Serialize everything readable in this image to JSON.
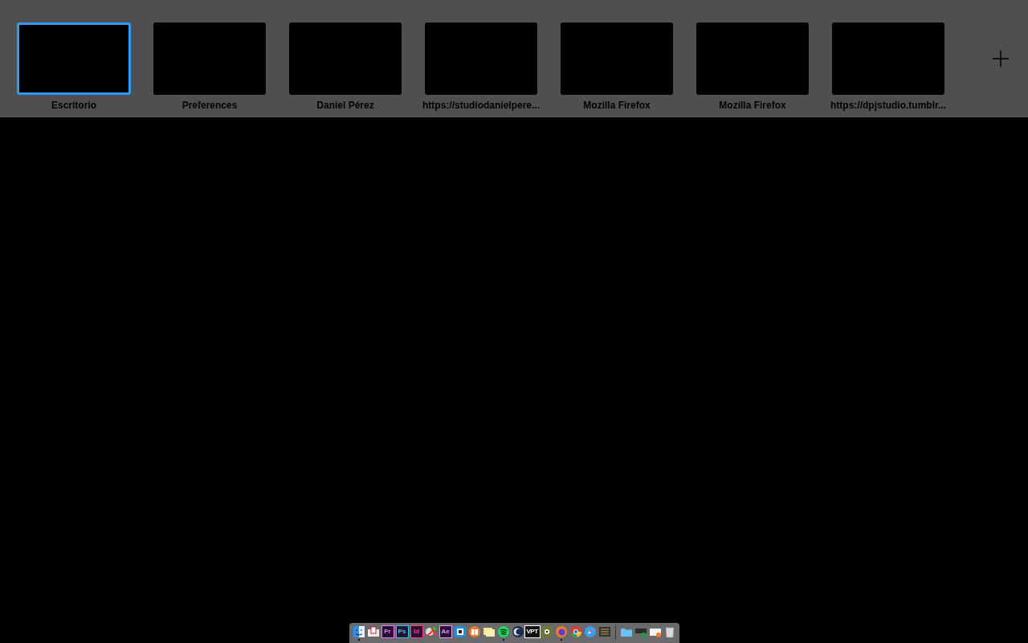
{
  "spaces": [
    {
      "label": "Escritorio",
      "selected": true
    },
    {
      "label": "Preferences",
      "selected": false
    },
    {
      "label": "Daniel Pérez",
      "selected": false
    },
    {
      "label": "https://studiodanielpere...",
      "selected": false
    },
    {
      "label": "Mozilla Firefox",
      "selected": false
    },
    {
      "label": "Mozilla Firefox",
      "selected": false
    },
    {
      "label": "https://dpjstudio.tumblr...",
      "selected": false
    }
  ],
  "dock": {
    "apps": [
      {
        "kind": "finder",
        "running": true
      },
      {
        "kind": "document",
        "running": false
      },
      {
        "kind": "badge",
        "label": "Pr",
        "color": "#e77bff",
        "running": false
      },
      {
        "kind": "badge",
        "label": "Ps",
        "color": "#31c5f0",
        "running": false
      },
      {
        "kind": "badge",
        "label": "Id",
        "color": "#ff3d83",
        "running": false
      },
      {
        "kind": "sticker",
        "running": false
      },
      {
        "kind": "badge",
        "label": "Ae",
        "color": "#d89cff",
        "running": false
      },
      {
        "kind": "screen",
        "running": false
      },
      {
        "kind": "book",
        "running": false
      },
      {
        "kind": "notes",
        "running": false
      },
      {
        "kind": "spotify",
        "running": true
      },
      {
        "kind": "sphere",
        "running": false
      },
      {
        "kind": "textbox",
        "label": "VPT",
        "running": false
      },
      {
        "kind": "grid",
        "running": false
      },
      {
        "kind": "firefox",
        "running": true
      },
      {
        "kind": "chrome",
        "running": false
      },
      {
        "kind": "compass",
        "running": false
      },
      {
        "kind": "panel",
        "running": false
      }
    ],
    "stacks": [
      {
        "kind": "folder"
      },
      {
        "kind": "device"
      },
      {
        "kind": "letter"
      },
      {
        "kind": "trash"
      }
    ]
  }
}
